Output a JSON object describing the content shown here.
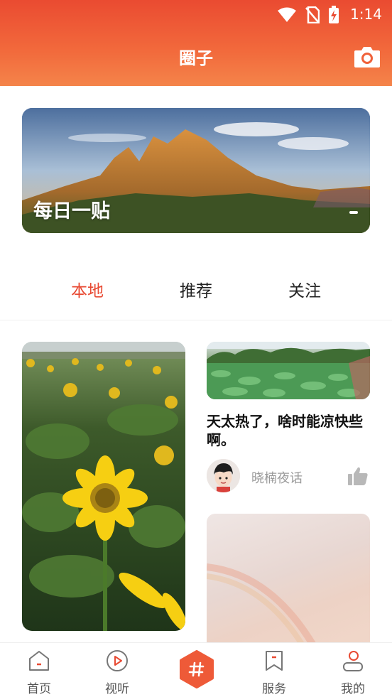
{
  "status_bar": {
    "time": "1:14"
  },
  "header": {
    "title": "圈子"
  },
  "banner": {
    "title": "每日一贴"
  },
  "tabs": [
    {
      "label": "本地",
      "active": true
    },
    {
      "label": "推荐",
      "active": false
    },
    {
      "label": "关注",
      "active": false
    }
  ],
  "feed": {
    "right_card": {
      "title": "天太热了，啥时能凉快些啊。",
      "author": "晓楠夜话"
    }
  },
  "bottom_nav": [
    {
      "label": "首页",
      "icon": "home-icon"
    },
    {
      "label": "视听",
      "icon": "play-icon"
    },
    {
      "label": "",
      "icon": "hashtag-icon"
    },
    {
      "label": "服务",
      "icon": "bookmark-icon"
    },
    {
      "label": "我的",
      "icon": "user-icon"
    }
  ],
  "colors": {
    "accent": "#e84a33",
    "header_gradient_start": "#ea4b31",
    "header_gradient_end": "#f4844a"
  }
}
